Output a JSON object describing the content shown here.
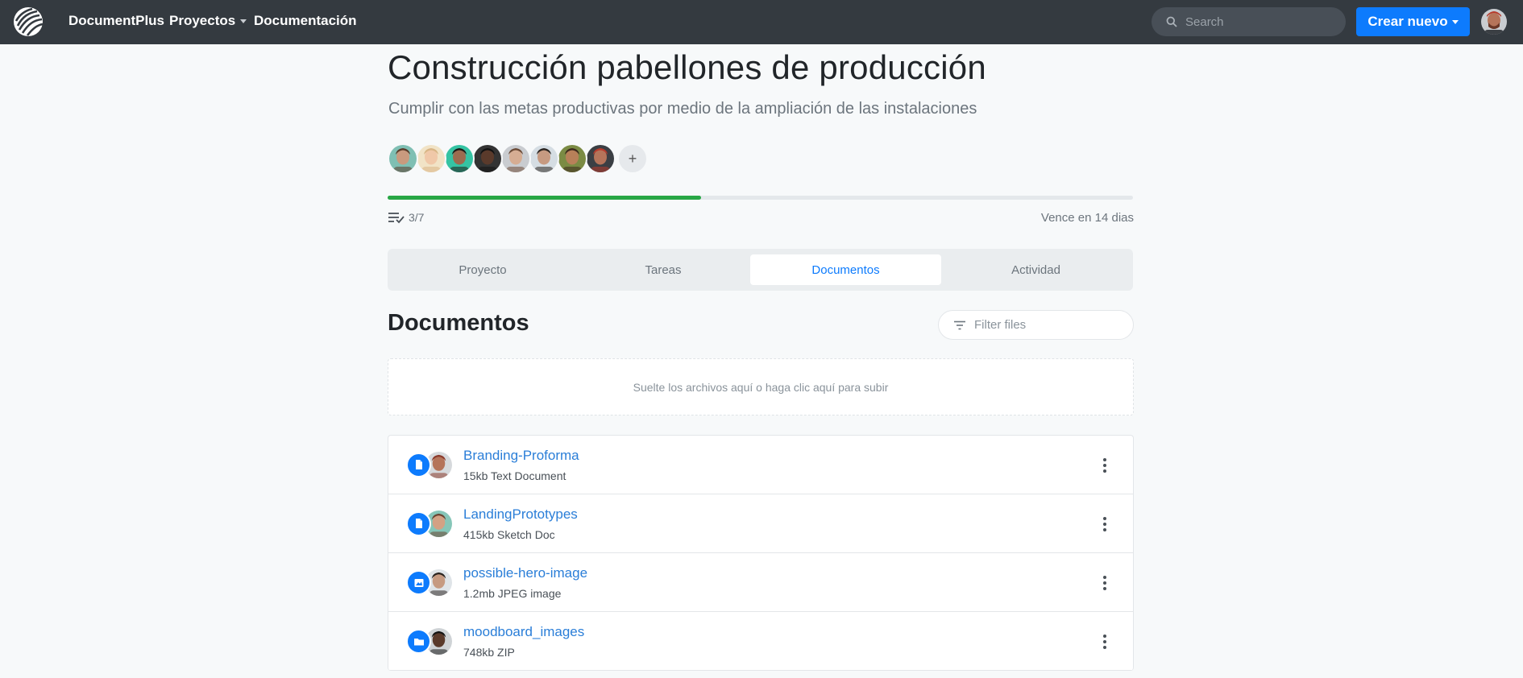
{
  "navbar": {
    "brand": "DocumentPlus",
    "links": [
      {
        "label": "Proyectos",
        "dropdown": true
      },
      {
        "label": "Documentación",
        "dropdown": false
      }
    ],
    "search_placeholder": "Search",
    "create_label": "Crear nuevo"
  },
  "project": {
    "title": "Construcción pabellones de producción",
    "subtitle": "Cumplir con las metas productivas por medio de la ampliación de las instalaciones",
    "add_member_label": "+",
    "progress": 0.42,
    "tasks": "3/7",
    "due": "Vence en 14 dias"
  },
  "members": [
    {
      "skin": "#c99a7e",
      "hair": "#5a3b2a",
      "bg": "#7fbfb3"
    },
    {
      "skin": "#f0c8a8",
      "hair": "#d8b585",
      "bg": "#f1e3c6"
    },
    {
      "skin": "#9c6b4f",
      "hair": "#1d1a18",
      "bg": "#35c3a3"
    },
    {
      "skin": "#5a3a2b",
      "hair": "#121212",
      "bg": "#333"
    },
    {
      "skin": "#d6ad93",
      "hair": "#6b4a36",
      "bg": "#c9ccd0"
    },
    {
      "skin": "#c69a81",
      "hair": "#2a2420",
      "bg": "#d5dde3"
    },
    {
      "skin": "#b88059",
      "hair": "#3d2a1d",
      "bg": "#7b8b44"
    },
    {
      "skin": "#b5745a",
      "hair": "#b73b2c",
      "bg": "#3b3f44"
    }
  ],
  "tabs": [
    {
      "label": "Proyecto",
      "active": false
    },
    {
      "label": "Tareas",
      "active": false
    },
    {
      "label": "Documentos",
      "active": true
    },
    {
      "label": "Actividad",
      "active": false
    }
  ],
  "documents": {
    "title": "Documentos",
    "filter_placeholder": "Filter files",
    "dropzone_text": "Suelte los archivos aquí o haga clic aquí para subir",
    "files": [
      {
        "name": "Branding-Proforma",
        "meta": "15kb Text Document",
        "icon": "document-icon",
        "user": {
          "skin": "#b5745a",
          "hair": "#8b3a2b",
          "bg": "#d6d9dc"
        }
      },
      {
        "name": "LandingPrototypes",
        "meta": "415kb Sketch Doc",
        "icon": "document-icon",
        "user": {
          "skin": "#d3a184",
          "hair": "#6b4532",
          "bg": "#86c6b8"
        }
      },
      {
        "name": "possible-hero-image",
        "meta": "1.2mb JPEG image",
        "icon": "image-icon",
        "user": {
          "skin": "#c69a81",
          "hair": "#2a2420",
          "bg": "#dfe4e8"
        }
      },
      {
        "name": "moodboard_images",
        "meta": "748kb ZIP",
        "icon": "folder-icon",
        "user": {
          "skin": "#5a3a2b",
          "hair": "#141414",
          "bg": "#cfd3d6"
        }
      }
    ]
  },
  "colors": {
    "navbar": "#343a40",
    "primary": "#0d7bfd",
    "progress": "#28a745",
    "link": "#2a7ed8"
  }
}
